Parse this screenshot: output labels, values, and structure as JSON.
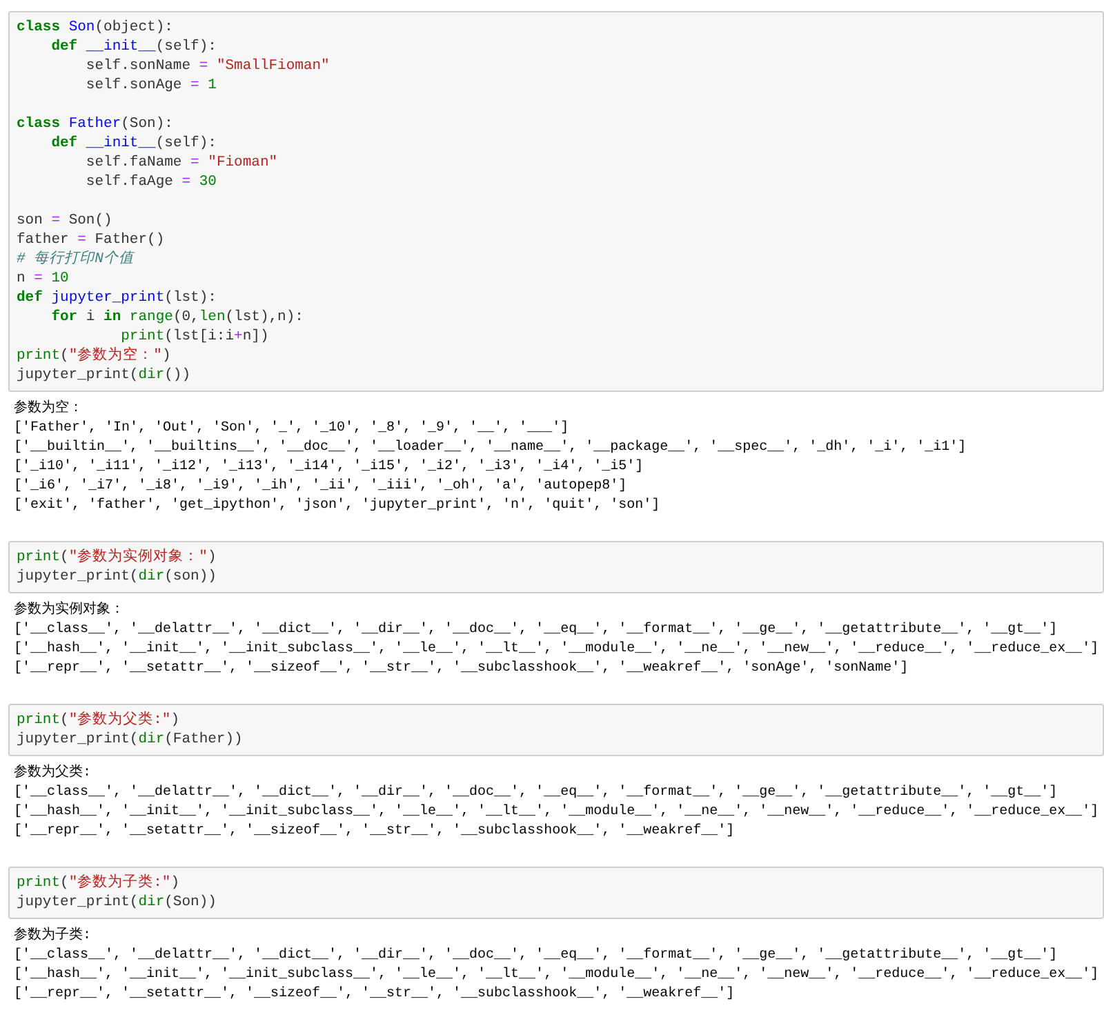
{
  "cells": [
    {
      "input": [
        [
          [
            {
              "kind": "keyword",
              "text": "class "
            },
            {
              "kind": "classname",
              "text": "Son"
            },
            {
              "kind": "plain",
              "text": "(object):"
            }
          ],
          [
            {
              "kind": "keyword",
              "text": "    def "
            },
            {
              "kind": "funcname",
              "text": "__init__"
            },
            {
              "kind": "plain",
              "text": "(self):"
            }
          ],
          [
            {
              "kind": "plain",
              "text": "        self.sonName "
            },
            {
              "kind": "operator",
              "text": "= "
            },
            {
              "kind": "string",
              "text": "\"SmallFioman\""
            }
          ],
          [
            {
              "kind": "plain",
              "text": "        self.sonAge "
            },
            {
              "kind": "operator",
              "text": "= "
            },
            {
              "kind": "number",
              "text": "1"
            }
          ]
        ],
        [
          [
            {
              "kind": "keyword",
              "text": "class "
            },
            {
              "kind": "classname",
              "text": "Father"
            },
            {
              "kind": "plain",
              "text": "(Son):"
            }
          ],
          [
            {
              "kind": "keyword",
              "text": "    def "
            },
            {
              "kind": "funcname",
              "text": "__init__"
            },
            {
              "kind": "plain",
              "text": "(self):"
            }
          ],
          [
            {
              "kind": "plain",
              "text": "        self.faName "
            },
            {
              "kind": "operator",
              "text": "= "
            },
            {
              "kind": "string",
              "text": "\"Fioman\""
            }
          ],
          [
            {
              "kind": "plain",
              "text": "        self.faAge "
            },
            {
              "kind": "operator",
              "text": "= "
            },
            {
              "kind": "number",
              "text": "30"
            }
          ]
        ],
        [
          [
            {
              "kind": "plain",
              "text": "son "
            },
            {
              "kind": "operator",
              "text": "="
            },
            {
              "kind": "plain",
              "text": " Son()"
            }
          ],
          [
            {
              "kind": "plain",
              "text": "father "
            },
            {
              "kind": "operator",
              "text": "="
            },
            {
              "kind": "plain",
              "text": " Father()"
            }
          ],
          [
            {
              "kind": "comment",
              "text": "# 每行打印N个值"
            }
          ],
          [
            {
              "kind": "plain",
              "text": "n "
            },
            {
              "kind": "operator",
              "text": "= "
            },
            {
              "kind": "number",
              "text": "10"
            }
          ],
          [
            {
              "kind": "keyword",
              "text": "def "
            },
            {
              "kind": "funcname",
              "text": "jupyter_print"
            },
            {
              "kind": "plain",
              "text": "(lst):"
            }
          ],
          [
            {
              "kind": "keyword",
              "text": "    for"
            },
            {
              "kind": "plain",
              "text": " i "
            },
            {
              "kind": "keyword",
              "text": "in "
            },
            {
              "kind": "builtin",
              "text": "range"
            },
            {
              "kind": "plain",
              "text": "(0,"
            },
            {
              "kind": "builtin",
              "text": "len"
            },
            {
              "kind": "plain",
              "text": "(lst),n):"
            }
          ],
          [
            {
              "kind": "builtin",
              "text": "            print"
            },
            {
              "kind": "plain",
              "text": "(lst[i:i"
            },
            {
              "kind": "operator",
              "text": "+"
            },
            {
              "kind": "plain",
              "text": "n])"
            }
          ],
          [
            {
              "kind": "builtin",
              "text": "print"
            },
            {
              "kind": "plain",
              "text": "("
            },
            {
              "kind": "string",
              "text": "\"参数为空：\""
            },
            {
              "kind": "plain",
              "text": ")"
            }
          ],
          [
            {
              "kind": "plain",
              "text": "jupyter_print("
            },
            {
              "kind": "builtin",
              "text": "dir"
            },
            {
              "kind": "plain",
              "text": "())"
            }
          ]
        ]
      ],
      "output": [
        "参数为空：",
        "['Father', 'In', 'Out', 'Son', '_', '_10', '_8', '_9', '__', '___']",
        "['__builtin__', '__builtins__', '__doc__', '__loader__', '__name__', '__package__', '__spec__', '_dh', '_i', '_i1']",
        "['_i10', '_i11', '_i12', '_i13', '_i14', '_i15', '_i2', '_i3', '_i4', '_i5']",
        "['_i6', '_i7', '_i8', '_i9', '_ih', '_ii', '_iii', '_oh', 'a', 'autopep8']",
        "['exit', 'father', 'get_ipython', 'json', 'jupyter_print', 'n', 'quit', 'son']"
      ]
    },
    {
      "input": [
        [
          [
            {
              "kind": "builtin",
              "text": "print"
            },
            {
              "kind": "plain",
              "text": "("
            },
            {
              "kind": "string",
              "text": "\"参数为实例对象：\""
            },
            {
              "kind": "plain",
              "text": ")"
            }
          ],
          [
            {
              "kind": "plain",
              "text": "jupyter_print("
            },
            {
              "kind": "builtin",
              "text": "dir"
            },
            {
              "kind": "plain",
              "text": "(son))"
            }
          ]
        ]
      ],
      "output": [
        "参数为实例对象：",
        "['__class__', '__delattr__', '__dict__', '__dir__', '__doc__', '__eq__', '__format__', '__ge__', '__getattribute__', '__gt__']",
        "['__hash__', '__init__', '__init_subclass__', '__le__', '__lt__', '__module__', '__ne__', '__new__', '__reduce__', '__reduce_ex__']",
        "['__repr__', '__setattr__', '__sizeof__', '__str__', '__subclasshook__', '__weakref__', 'sonAge', 'sonName']"
      ]
    },
    {
      "input": [
        [
          [
            {
              "kind": "builtin",
              "text": "print"
            },
            {
              "kind": "plain",
              "text": "("
            },
            {
              "kind": "string",
              "text": "\"参数为父类:\""
            },
            {
              "kind": "plain",
              "text": ")"
            }
          ],
          [
            {
              "kind": "plain",
              "text": "jupyter_print("
            },
            {
              "kind": "builtin",
              "text": "dir"
            },
            {
              "kind": "plain",
              "text": "(Father))"
            }
          ]
        ]
      ],
      "output": [
        "参数为父类:",
        "['__class__', '__delattr__', '__dict__', '__dir__', '__doc__', '__eq__', '__format__', '__ge__', '__getattribute__', '__gt__']",
        "['__hash__', '__init__', '__init_subclass__', '__le__', '__lt__', '__module__', '__ne__', '__new__', '__reduce__', '__reduce_ex__']",
        "['__repr__', '__setattr__', '__sizeof__', '__str__', '__subclasshook__', '__weakref__']"
      ]
    },
    {
      "input": [
        [
          [
            {
              "kind": "builtin",
              "text": "print"
            },
            {
              "kind": "plain",
              "text": "("
            },
            {
              "kind": "string",
              "text": "\"参数为子类:\""
            },
            {
              "kind": "plain",
              "text": ")"
            }
          ],
          [
            {
              "kind": "plain",
              "text": "jupyter_print("
            },
            {
              "kind": "builtin",
              "text": "dir"
            },
            {
              "kind": "plain",
              "text": "(Son))"
            }
          ]
        ]
      ],
      "output": [
        "参数为子类:",
        "['__class__', '__delattr__', '__dict__', '__dir__', '__doc__', '__eq__', '__format__', '__ge__', '__getattribute__', '__gt__']",
        "['__hash__', '__init__', '__init_subclass__', '__le__', '__lt__', '__module__', '__ne__', '__new__', '__reduce__', '__reduce_ex__']",
        "['__repr__', '__setattr__', '__sizeof__', '__str__', '__subclasshook__', '__weakref__']"
      ]
    }
  ]
}
